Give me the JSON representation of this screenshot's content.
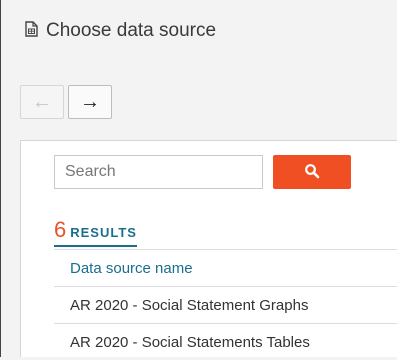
{
  "dialog": {
    "title": "Choose data source",
    "icon": "document-icon"
  },
  "nav": {
    "back_icon": "←",
    "forward_icon": "→"
  },
  "search": {
    "placeholder": "Search",
    "button_icon": "search-icon",
    "button_color": "#f04e23"
  },
  "results": {
    "count": "6",
    "label": "RESULTS"
  },
  "table": {
    "column_header": "Data source name",
    "rows": [
      "AR 2020 - Social Statement Graphs",
      "AR 2020 - Social Statements Tables"
    ]
  }
}
